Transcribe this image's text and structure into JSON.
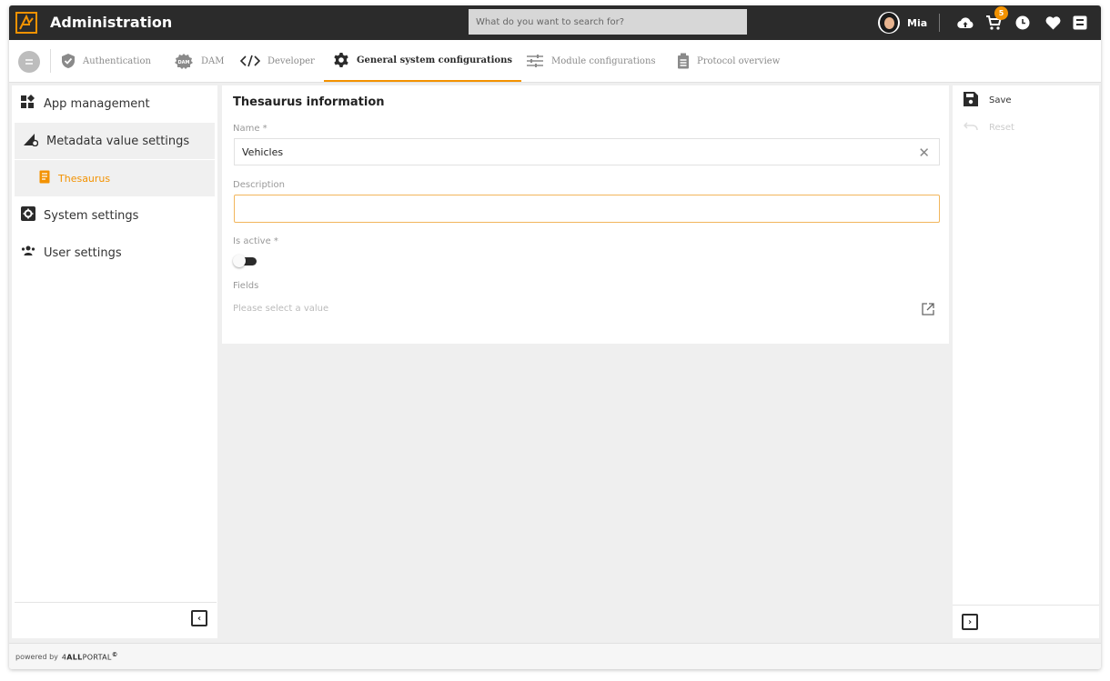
{
  "app": {
    "title": "Administration",
    "logo_icon": "allportal-logo-icon",
    "accent": "#f39200"
  },
  "search": {
    "placeholder": "What do you want to search for?"
  },
  "user": {
    "name": "Mia"
  },
  "topbar_icons": [
    "upload-cloud-icon",
    "cart-icon",
    "clock-icon",
    "heart-icon",
    "inbox-icon"
  ],
  "cart": {
    "badge": "5"
  },
  "tabs": [
    {
      "label": "Authentication",
      "icon": "shield-check-icon",
      "active": false
    },
    {
      "label": "DAM",
      "icon": "dam-icon",
      "active": false
    },
    {
      "label": "Developer",
      "icon": "code-icon",
      "active": false
    },
    {
      "label": "General system configurations",
      "icon": "gear-icon",
      "active": true
    },
    {
      "label": "Module configurations",
      "icon": "sliders-icon",
      "active": false
    },
    {
      "label": "Protocol overview",
      "icon": "clipboard-icon",
      "active": false
    }
  ],
  "sidebar": {
    "items": [
      {
        "label": "App management",
        "icon": "apps-icon"
      },
      {
        "label": "Metadata value settings",
        "icon": "metadata-icon"
      },
      {
        "label": "Thesaurus",
        "icon": "book-icon"
      },
      {
        "label": "System settings",
        "icon": "settings-box-icon"
      },
      {
        "label": "User settings",
        "icon": "users-icon"
      }
    ]
  },
  "form": {
    "title": "Thesaurus information",
    "name_label": "Name *",
    "name_value": "Vehicles",
    "description_label": "Description",
    "description_value": "",
    "active_label": "Is active *",
    "active_value": false,
    "fields_label": "Fields",
    "fields_placeholder": "Please select a value"
  },
  "actions": {
    "save_label": "Save",
    "reset_label": "Reset"
  },
  "footer": {
    "prefix": "powered by",
    "brand_number": "4",
    "brand_bold": "ALL",
    "brand_rest": "PORTAL",
    "mark": "©"
  }
}
